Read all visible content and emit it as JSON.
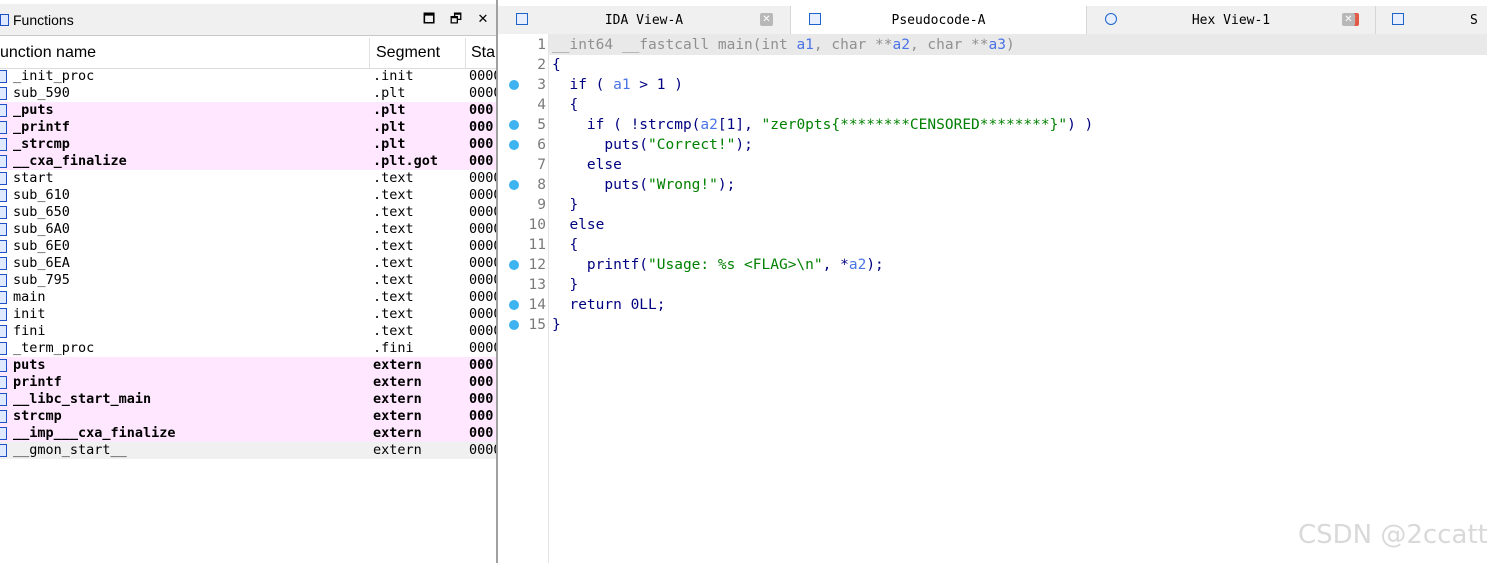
{
  "functions_panel": {
    "title": "Functions",
    "controls": {
      "maximize": "🗖",
      "restore": "🗗",
      "close": "✕"
    },
    "columns": {
      "name": "unction name",
      "segment": "Segment",
      "start": "Sta"
    },
    "rows": [
      {
        "name": "_init_proc",
        "segment": ".init",
        "start": "0000",
        "style": "normal"
      },
      {
        "name": "sub_590",
        "segment": ".plt",
        "start": "0000",
        "style": "normal"
      },
      {
        "name": "_puts",
        "segment": ".plt",
        "start": "000",
        "style": "extern"
      },
      {
        "name": "_printf",
        "segment": ".plt",
        "start": "000",
        "style": "extern"
      },
      {
        "name": "_strcmp",
        "segment": ".plt",
        "start": "000",
        "style": "extern"
      },
      {
        "name": "__cxa_finalize",
        "segment": ".plt.got",
        "start": "000",
        "style": "extern"
      },
      {
        "name": "start",
        "segment": ".text",
        "start": "0000",
        "style": "normal"
      },
      {
        "name": "sub_610",
        "segment": ".text",
        "start": "0000",
        "style": "normal"
      },
      {
        "name": "sub_650",
        "segment": ".text",
        "start": "0000",
        "style": "normal"
      },
      {
        "name": "sub_6A0",
        "segment": ".text",
        "start": "0000",
        "style": "normal"
      },
      {
        "name": "sub_6E0",
        "segment": ".text",
        "start": "0000",
        "style": "normal"
      },
      {
        "name": "sub_6EA",
        "segment": ".text",
        "start": "0000",
        "style": "normal"
      },
      {
        "name": "sub_795",
        "segment": ".text",
        "start": "0000",
        "style": "normal"
      },
      {
        "name": "main",
        "segment": ".text",
        "start": "0000",
        "style": "normal"
      },
      {
        "name": "init",
        "segment": ".text",
        "start": "0000",
        "style": "normal"
      },
      {
        "name": "fini",
        "segment": ".text",
        "start": "0000",
        "style": "normal"
      },
      {
        "name": "_term_proc",
        "segment": ".fini",
        "start": "0000",
        "style": "normal"
      },
      {
        "name": "puts",
        "segment": "extern",
        "start": "000",
        "style": "extern"
      },
      {
        "name": "printf",
        "segment": "extern",
        "start": "000",
        "style": "extern"
      },
      {
        "name": "__libc_start_main",
        "segment": "extern",
        "start": "000",
        "style": "extern"
      },
      {
        "name": "strcmp",
        "segment": "extern",
        "start": "000",
        "style": "extern"
      },
      {
        "name": "__imp___cxa_finalize",
        "segment": "extern",
        "start": "000",
        "style": "extern"
      },
      {
        "name": "__gmon_start__",
        "segment": "extern",
        "start": "0000",
        "style": "selected"
      }
    ]
  },
  "tabs": [
    {
      "label": "IDA View-A",
      "icon": "ida-view-icon",
      "active": false,
      "close": "✕"
    },
    {
      "label": "Pseudocode-A",
      "icon": "pseudocode-icon",
      "active": true,
      "close": "✕"
    },
    {
      "label": "Hex View-1",
      "icon": "hex-view-icon",
      "active": false,
      "close": "✕"
    },
    {
      "label": "S",
      "icon": "structures-icon",
      "active": false,
      "close": ""
    }
  ],
  "pseudocode": {
    "lines": [
      {
        "num": "1",
        "bp": false,
        "text": "__int64 __fastcall main(int a1, char **a2, char **a3)"
      },
      {
        "num": "2",
        "bp": false,
        "text": "{"
      },
      {
        "num": "3",
        "bp": true,
        "text": "  if ( a1 > 1 )"
      },
      {
        "num": "4",
        "bp": false,
        "text": "  {"
      },
      {
        "num": "5",
        "bp": true,
        "text": "    if ( !strcmp(a2[1], \"zer0pts{********CENSORED********}\") )"
      },
      {
        "num": "6",
        "bp": true,
        "text": "      puts(\"Correct!\");"
      },
      {
        "num": "7",
        "bp": false,
        "text": "    else"
      },
      {
        "num": "8",
        "bp": true,
        "text": "      puts(\"Wrong!\");"
      },
      {
        "num": "9",
        "bp": false,
        "text": "  }"
      },
      {
        "num": "10",
        "bp": false,
        "text": "  else"
      },
      {
        "num": "11",
        "bp": false,
        "text": "  {"
      },
      {
        "num": "12",
        "bp": true,
        "text": "    printf(\"Usage: %s <FLAG>\\n\", *a2);"
      },
      {
        "num": "13",
        "bp": false,
        "text": "  }"
      },
      {
        "num": "14",
        "bp": true,
        "text": "  return 0LL;"
      },
      {
        "num": "15",
        "bp": true,
        "text": "}"
      }
    ]
  },
  "watermark": "CSDN @2ccatt",
  "colors": {
    "extern_row_bg": "#ffe8ff",
    "keyword": "#000080",
    "string": "#008000",
    "variable": "#4b74e6",
    "breakpoint": "#3eb3f0",
    "active_tab_close": "#e25a46"
  }
}
